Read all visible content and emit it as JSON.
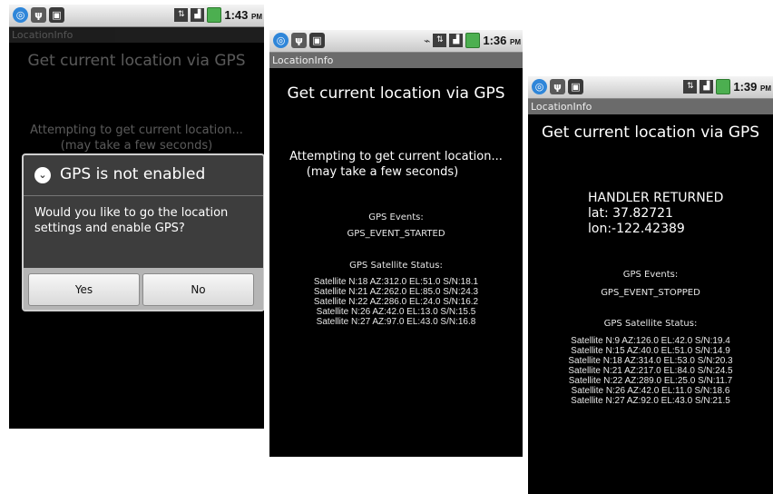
{
  "screens": [
    {
      "status": {
        "time": "1:43",
        "ampm": "PM"
      },
      "app_title": "LocationInfo",
      "heading": "Get current location via GPS",
      "attempt_line1": "Attempting to get current location...",
      "attempt_line2": "(may take a few seconds)",
      "dialog": {
        "title": "GPS is not enabled",
        "message": "Would you like to go the location settings and enable GPS?",
        "yes": "Yes",
        "no": "No"
      }
    },
    {
      "status": {
        "time": "1:36",
        "ampm": "PM"
      },
      "app_title": "LocationInfo",
      "heading": "Get current location via GPS",
      "attempt_line1": "Attempting to get current location...",
      "attempt_line2": "(may take a few seconds)",
      "events_label": "GPS Events:",
      "event": "GPS_EVENT_STARTED",
      "sat_label": "GPS Satellite Status:",
      "satellites": [
        "Satellite N:18 AZ:312.0 EL:51.0 S/N:18.1",
        "Satellite N:21 AZ:262.0 EL:85.0 S/N:24.3",
        "Satellite N:22 AZ:286.0 EL:24.0 S/N:16.2",
        "Satellite N:26 AZ:42.0 EL:13.0 S/N:15.5",
        "Satellite N:27 AZ:97.0 EL:43.0 S/N:16.8"
      ]
    },
    {
      "status": {
        "time": "1:39",
        "ampm": "PM"
      },
      "app_title": "LocationInfo",
      "heading": "Get current location via GPS",
      "handler": "HANDLER RETURNED",
      "lat_label": "lat:",
      "lat_value": "37.82721",
      "lon_label": "lon:",
      "lon_value": "-122.42389",
      "events_label": "GPS Events:",
      "event": "GPS_EVENT_STOPPED",
      "sat_label": "GPS Satellite Status:",
      "satellites": [
        "Satellite N:9 AZ:126.0 EL:42.0 S/N:19.4",
        "Satellite N:15 AZ:40.0 EL:51.0 S/N:14.9",
        "Satellite N:18 AZ:314.0 EL:53.0 S/N:20.3",
        "Satellite N:21 AZ:217.0 EL:84.0 S/N:24.5",
        "Satellite N:22 AZ:289.0 EL:25.0 S/N:11.7",
        "Satellite N:26 AZ:42.0 EL:11.0 S/N:18.6",
        "Satellite N:27 AZ:92.0 EL:43.0 S/N:21.5"
      ]
    }
  ]
}
